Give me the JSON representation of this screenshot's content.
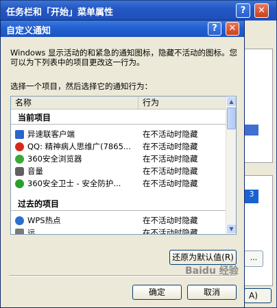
{
  "background_window": {
    "title": "任务栏和「开始」菜单属性",
    "help_label": "?",
    "close_label": "✕",
    "panel_glyph": "3",
    "dots_label": "...",
    "apply_label": "A)"
  },
  "dialog": {
    "title": "自定义通知",
    "help_label": "?",
    "close_label": "✕",
    "description": "Windows 显示活动的和紧急的通知图标，隐藏不活动的图标。您可以为下列表中的项目更改这一行为。",
    "instruction": "选择一个项目，然后选择它的通知行为：",
    "columns": {
      "name": "名称",
      "behavior": "行为"
    },
    "sections": {
      "current": "当前项目",
      "past": "过去的项目"
    },
    "current_items": [
      {
        "name": "异速联客户端",
        "behavior": "在不活动时隐藏",
        "icon": "network-client-icon",
        "color": "#2a66c8"
      },
      {
        "name": "QQ: 精神病人思维广(7865...",
        "behavior": "在不活动时隐藏",
        "icon": "qq-penguin-icon",
        "color": "#d42a1c"
      },
      {
        "name": "360安全浏览器",
        "behavior": "在不活动时隐藏",
        "icon": "browser-icon",
        "color": "#3aa83a"
      },
      {
        "name": "音量",
        "behavior": "在不活动时隐藏",
        "icon": "speaker-icon",
        "color": "#606060"
      },
      {
        "name": "360安全卫士 - 安全防护...",
        "behavior": "在不活动时隐藏",
        "icon": "shield-icon",
        "color": "#2aa02a"
      }
    ],
    "past_items": [
      {
        "name": "WPS热点",
        "behavior": "在不活动时隐藏",
        "icon": "wps-icon",
        "color": "#2a70d0"
      },
      {
        "name": "远",
        "behavior": "在不活动时隐藏",
        "icon": "app-icon",
        "color": "#7a7a7a"
      }
    ],
    "restore_label": "还原为默认值(R)",
    "ok_label": "确定",
    "cancel_label": "取消"
  },
  "watermark": "Baidu 经验"
}
